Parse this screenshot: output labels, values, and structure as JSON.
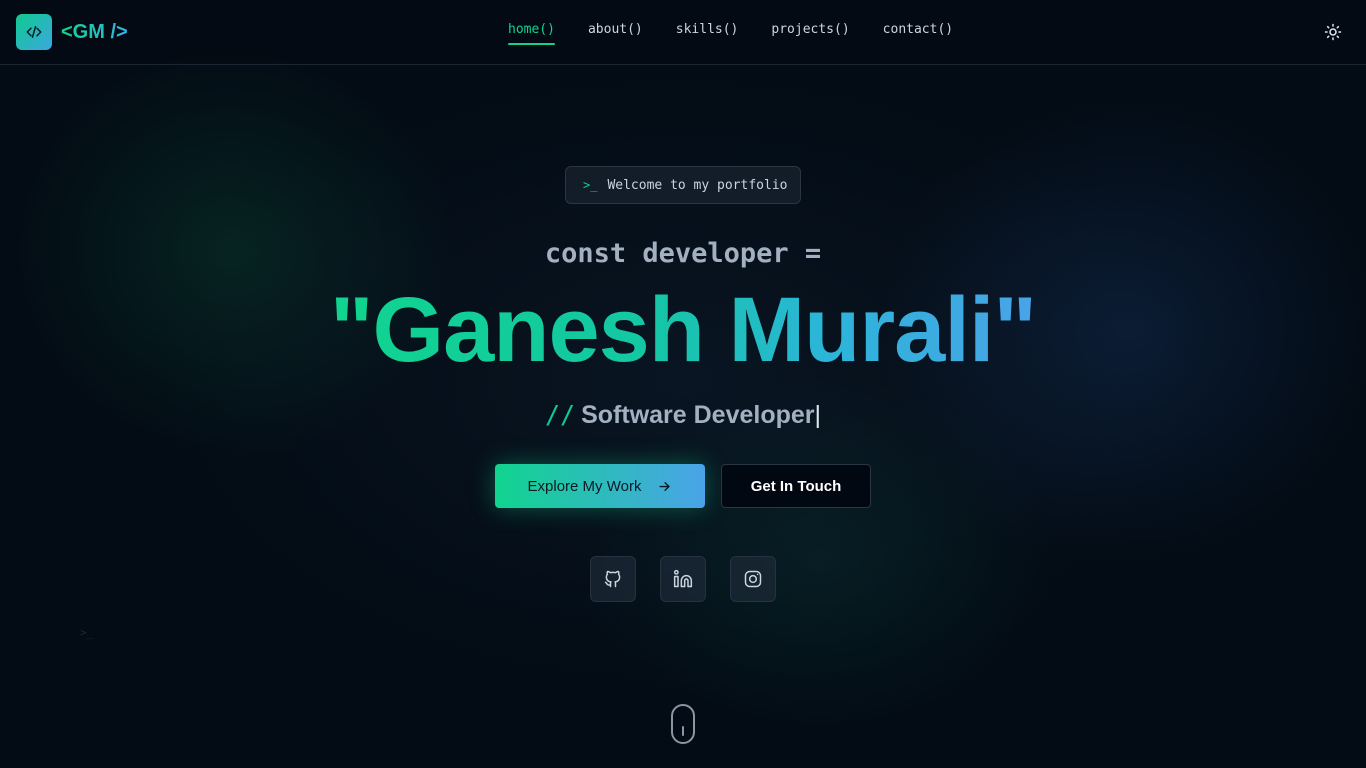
{
  "header": {
    "logo_text": "<GM />",
    "nav": [
      {
        "label": "home()",
        "active": true
      },
      {
        "label": "about()",
        "active": false
      },
      {
        "label": "skills()",
        "active": false
      },
      {
        "label": "projects()",
        "active": false
      },
      {
        "label": "contact()",
        "active": false
      }
    ],
    "theme_icon": "sun-icon"
  },
  "hero": {
    "badge_prompt": ">_",
    "badge_text": "Welcome to my portfolio",
    "const_line": "const developer =",
    "name": "\"Ganesh Murali\"",
    "role_prefix": "//",
    "role": "Software Developer",
    "caret": "|",
    "primary_button": "Explore My Work",
    "secondary_button": "Get In Touch",
    "socials": [
      "github-icon",
      "linkedin-icon",
      "instagram-icon"
    ],
    "faint_glyph": ">_"
  },
  "colors": {
    "accent_green": "#10d48e",
    "accent_blue": "#4aa3e8",
    "background": "#030b14"
  }
}
